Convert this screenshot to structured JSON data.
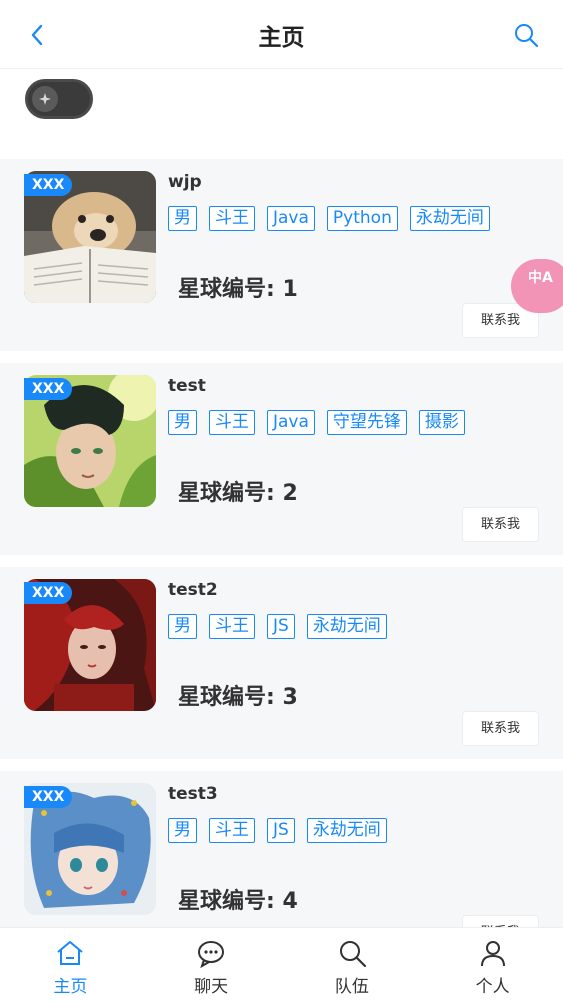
{
  "header": {
    "title": "主页",
    "back_icon": "chevron-left-icon",
    "search_icon": "search-icon"
  },
  "toggle": {
    "on": false
  },
  "floating": {
    "label": "中A",
    "icon": "translate-icon"
  },
  "users": [
    {
      "badge": "XXX",
      "name": "wjp",
      "tags": [
        "男",
        "斗王",
        "Java",
        "Python",
        "永劫无间"
      ],
      "star": "星球编号: 1",
      "contact": "联系我"
    },
    {
      "badge": "XXX",
      "name": "test",
      "tags": [
        "男",
        "斗王",
        "Java",
        "守望先锋",
        "摄影"
      ],
      "star": "星球编号: 2",
      "contact": "联系我"
    },
    {
      "badge": "XXX",
      "name": "test2",
      "tags": [
        "男",
        "斗王",
        "JS",
        "永劫无间"
      ],
      "star": "星球编号: 3",
      "contact": "联系我"
    },
    {
      "badge": "XXX",
      "name": "test3",
      "tags": [
        "男",
        "斗王",
        "JS",
        "永劫无间"
      ],
      "star": "星球编号: 4",
      "contact": "联系我"
    }
  ],
  "tabbar": [
    {
      "label": "主页",
      "icon": "home-icon",
      "active": true
    },
    {
      "label": "聊天",
      "icon": "chat-icon",
      "active": false
    },
    {
      "label": "队伍",
      "icon": "search-icon",
      "active": false
    },
    {
      "label": "个人",
      "icon": "user-icon",
      "active": false
    }
  ],
  "colors": {
    "accent": "#1989fa",
    "card_bg": "#f6f7f9",
    "float_bg": "#f28cb0"
  }
}
